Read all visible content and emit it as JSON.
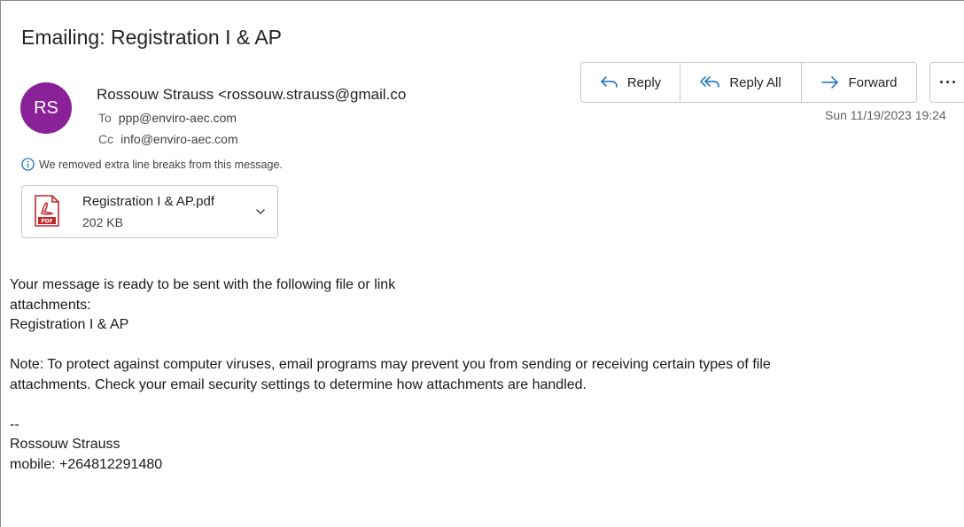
{
  "email": {
    "subject": "Emailing: Registration I & AP",
    "avatar_initials": "RS",
    "sender": "Rossouw Strauss <rossouw.strauss@gmail.com>",
    "to_label": "To",
    "to": "ppp@enviro-aec.com",
    "cc_label": "Cc",
    "cc": "info@enviro-aec.com",
    "info_notice": "We removed extra line breaks from this message.",
    "timestamp": "Sun 11/19/2023 19:24"
  },
  "attachment": {
    "name": "Registration I & AP.pdf",
    "size": "202 KB",
    "icon": "pdf-icon"
  },
  "actions": {
    "reply_label": "Reply",
    "reply_all_label": "Reply All",
    "forward_label": "Forward",
    "more_label": "···"
  },
  "body": {
    "line1": "Your message is ready to be sent with the following file or link",
    "line2": "attachments:",
    "line3": "Registration I & AP",
    "note1": "Note: To protect against computer viruses, email programs may prevent you from sending or receiving certain types of file",
    "note2": "attachments. Check your email security settings to determine how attachments are handled.",
    "sig_sep": "--",
    "sig_name": "Rossouw Strauss",
    "sig_mobile": "mobile: +264812291480"
  },
  "colors": {
    "avatar": "#8a2198",
    "accent": "#0f6cbd",
    "pdf_red": "#c4262e"
  }
}
